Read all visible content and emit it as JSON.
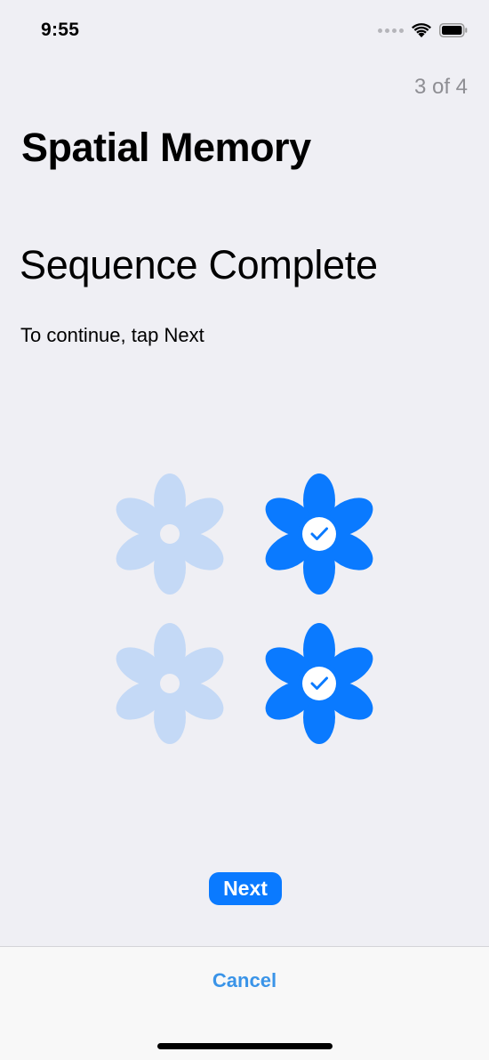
{
  "status_bar": {
    "time": "9:55"
  },
  "header": {
    "step_counter": "3 of 4",
    "title": "Spatial Memory"
  },
  "content": {
    "headline": "Sequence Complete",
    "instruction": "To continue, tap Next"
  },
  "grid": {
    "flowers": [
      {
        "state": "inactive",
        "icon": "flower-icon"
      },
      {
        "state": "selected",
        "icon": "flower-check-icon"
      },
      {
        "state": "inactive",
        "icon": "flower-icon"
      },
      {
        "state": "selected",
        "icon": "flower-check-icon"
      }
    ]
  },
  "actions": {
    "next_label": "Next",
    "cancel_label": "Cancel"
  },
  "colors": {
    "accent": "#0a7aff",
    "inactive_flower": "#c4d9f6",
    "background": "#efeff4",
    "cancel_text": "#3a94e8"
  }
}
